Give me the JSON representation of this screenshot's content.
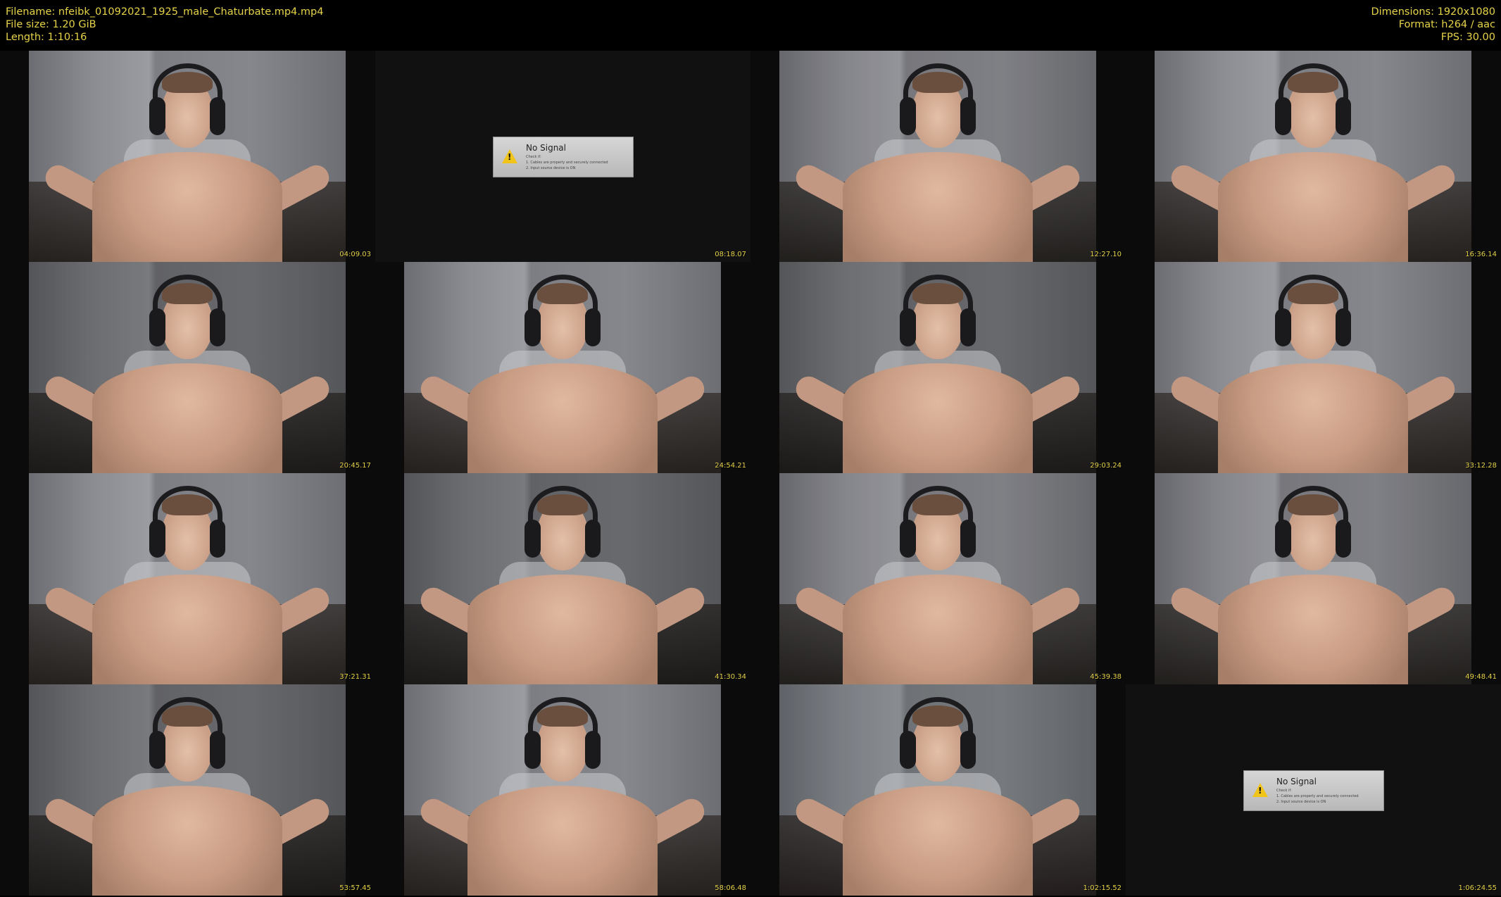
{
  "header": {
    "filename": "Filename: nfeibk_01092021_1925_male_Chaturbate.mp4.mp4",
    "filesize": "File size: 1.20 GiB",
    "length": "Length: 1:10:16",
    "dimensions": "Dimensions: 1920x1080",
    "format": "Format: h264 / aac",
    "fps": "FPS: 30.00"
  },
  "no_signal": {
    "title": "No Signal",
    "line1": "Check if:",
    "line2": "1. Cables are properly and securely connected",
    "line3": "2. Input source device is ON"
  },
  "thumbnails": [
    {
      "time": "04:09.03",
      "kind": "webcam"
    },
    {
      "time": "08:18.07",
      "kind": "no-signal"
    },
    {
      "time": "12:27.10",
      "kind": "webcam"
    },
    {
      "time": "16:36.14",
      "kind": "webcam"
    },
    {
      "time": "20:45.17",
      "kind": "webcam"
    },
    {
      "time": "24:54.21",
      "kind": "webcam"
    },
    {
      "time": "29:03.24",
      "kind": "webcam"
    },
    {
      "time": "33:12.28",
      "kind": "webcam"
    },
    {
      "time": "37:21.31",
      "kind": "webcam"
    },
    {
      "time": "41:30.34",
      "kind": "webcam"
    },
    {
      "time": "45:39.38",
      "kind": "webcam"
    },
    {
      "time": "49:48.41",
      "kind": "webcam"
    },
    {
      "time": "53:57.45",
      "kind": "webcam"
    },
    {
      "time": "58:06.48",
      "kind": "webcam"
    },
    {
      "time": "1:02:15.52",
      "kind": "webcam"
    },
    {
      "time": "1:06:24.55",
      "kind": "no-signal"
    }
  ],
  "colors": {
    "text_accent": "#e6d34a",
    "background": "#000000",
    "warning": "#f0c419"
  }
}
